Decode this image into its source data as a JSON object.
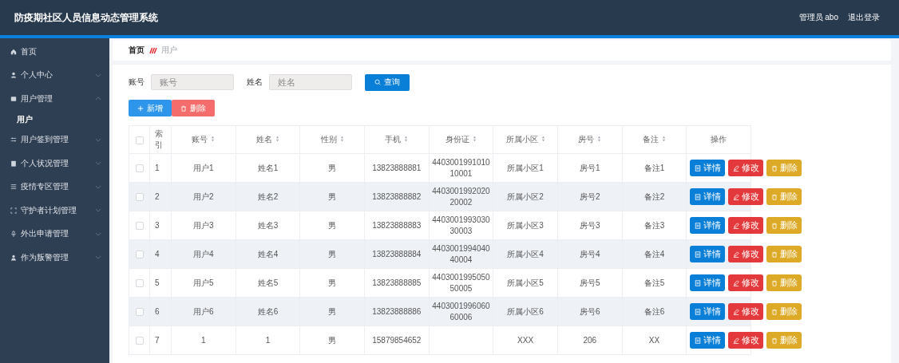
{
  "header": {
    "title": "防疫期社区人员信息动态管理系统",
    "user": "管理员 abo",
    "logout": "退出登录"
  },
  "sidebar": {
    "items": [
      {
        "label": "首页",
        "kind": "home",
        "selected": false
      },
      {
        "label": "个人中心",
        "kind": "user",
        "selected": false,
        "expanded": false
      },
      {
        "label": "用户管理",
        "kind": "doc",
        "selected": false,
        "expanded": true,
        "children": [
          {
            "label": "用户",
            "selected": true
          }
        ]
      },
      {
        "label": "用户签到管理",
        "kind": "sliders",
        "selected": false,
        "expanded": false
      },
      {
        "label": "个人状况管理",
        "kind": "clipboard",
        "selected": false,
        "expanded": false
      },
      {
        "label": "疫情专区管理",
        "kind": "list",
        "selected": false,
        "expanded": false
      },
      {
        "label": "守护者计划管理",
        "kind": "frame",
        "selected": false,
        "expanded": false
      },
      {
        "label": "外出申请管理",
        "kind": "mic",
        "selected": false,
        "expanded": false
      },
      {
        "label": "作为叛警管理",
        "kind": "person",
        "selected": false,
        "expanded": false
      }
    ]
  },
  "breadcrumb": [
    "首页",
    "用户"
  ],
  "search": {
    "fields": [
      {
        "label": "账号",
        "placeholder": "账号"
      },
      {
        "label": "姓名",
        "placeholder": "姓名"
      }
    ],
    "button": "查询"
  },
  "actions": [
    {
      "label": "新增",
      "kind": "add"
    },
    {
      "label": "删除",
      "kind": "delete"
    }
  ],
  "table": {
    "header_checked": false,
    "columns": [
      {
        "label": "索引",
        "sortable": false
      },
      {
        "label": "账号",
        "sortable": true
      },
      {
        "label": "姓名",
        "sortable": true
      },
      {
        "label": "性别",
        "sortable": true
      },
      {
        "label": "手机",
        "sortable": true
      },
      {
        "label": "身份证",
        "sortable": true
      },
      {
        "label": "所属小区",
        "sortable": true
      },
      {
        "label": "房号",
        "sortable": true
      },
      {
        "label": "备注",
        "sortable": true
      },
      {
        "label": "操作",
        "sortable": false
      }
    ],
    "rows": [
      {
        "checked": false,
        "cells": [
          "1",
          "用户1",
          "姓名1",
          "男",
          "13823888881",
          "440300199101010001",
          "所属小区1",
          "房号1",
          "备注1"
        ],
        "actions": [
          {
            "label": "详情",
            "kind": "view"
          },
          {
            "label": "修改",
            "kind": "edit"
          },
          {
            "label": "删除",
            "kind": "delete"
          }
        ]
      },
      {
        "checked": false,
        "cells": [
          "2",
          "用户2",
          "姓名2",
          "男",
          "13823888882",
          "440300199202020002",
          "所属小区2",
          "房号2",
          "备注2"
        ],
        "actions": [
          {
            "label": "详情",
            "kind": "view"
          },
          {
            "label": "修改",
            "kind": "edit"
          },
          {
            "label": "删除",
            "kind": "delete"
          }
        ]
      },
      {
        "checked": false,
        "cells": [
          "3",
          "用户3",
          "姓名3",
          "男",
          "13823888883",
          "440300199303030003",
          "所属小区3",
          "房号3",
          "备注3"
        ],
        "actions": [
          {
            "label": "详情",
            "kind": "view"
          },
          {
            "label": "修改",
            "kind": "edit"
          },
          {
            "label": "删除",
            "kind": "delete"
          }
        ]
      },
      {
        "checked": false,
        "cells": [
          "4",
          "用户4",
          "姓名4",
          "男",
          "13823888884",
          "440300199404040004",
          "所属小区4",
          "房号4",
          "备注4"
        ],
        "actions": [
          {
            "label": "详情",
            "kind": "view"
          },
          {
            "label": "修改",
            "kind": "edit"
          },
          {
            "label": "删除",
            "kind": "delete"
          }
        ]
      },
      {
        "checked": false,
        "cells": [
          "5",
          "用户5",
          "姓名5",
          "男",
          "13823888885",
          "440300199505050005",
          "所属小区5",
          "房号5",
          "备注5"
        ],
        "actions": [
          {
            "label": "详情",
            "kind": "view"
          },
          {
            "label": "修改",
            "kind": "edit"
          },
          {
            "label": "删除",
            "kind": "delete"
          }
        ]
      },
      {
        "checked": false,
        "cells": [
          "6",
          "用户6",
          "姓名6",
          "男",
          "13823888886",
          "440300199606060006",
          "所属小区6",
          "房号6",
          "备注6"
        ],
        "actions": [
          {
            "label": "详情",
            "kind": "view"
          },
          {
            "label": "修改",
            "kind": "edit"
          },
          {
            "label": "删除",
            "kind": "delete"
          }
        ]
      },
      {
        "checked": false,
        "cells": [
          "7",
          "1",
          "1",
          "男",
          "15879854652",
          null,
          "XXX",
          "206",
          "XX"
        ],
        "actions": [
          {
            "label": "详情",
            "kind": "view"
          },
          {
            "label": "修改",
            "kind": "edit"
          },
          {
            "label": "删除",
            "kind": "delete"
          }
        ]
      }
    ]
  }
}
